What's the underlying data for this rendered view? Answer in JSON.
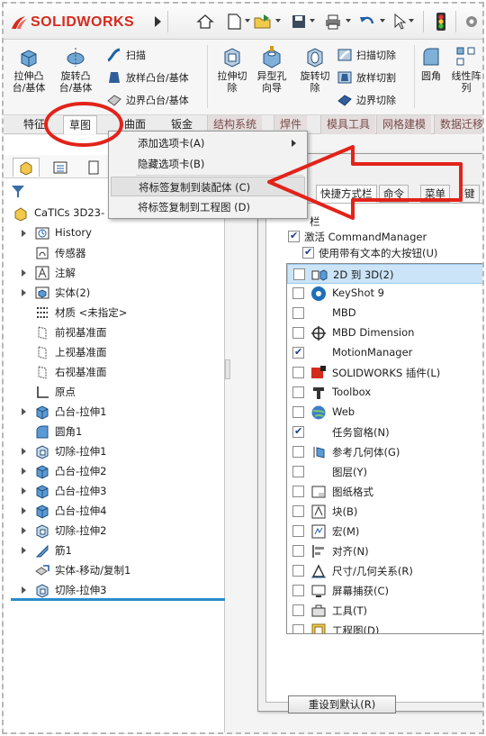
{
  "app": {
    "brand": "SOLIDWORKS"
  },
  "ribbon": {
    "items": [
      {
        "label": "拉伸凸\n台/基体",
        "icon": "extrude-boss-icon"
      },
      {
        "label": "旋转凸\n台/基体",
        "icon": "revolve-boss-icon"
      },
      {
        "label": "扫描",
        "icon": "sweep-icon"
      },
      {
        "label": "放样凸台/基体",
        "icon": "loft-icon"
      },
      {
        "label": "边界凸台/基体",
        "icon": "boundary-boss-icon"
      },
      {
        "label": "拉伸切\n除",
        "icon": "extrude-cut-icon"
      },
      {
        "label": "异型孔\n向导",
        "icon": "hole-wizard-icon"
      },
      {
        "label": "旋转切\n除",
        "icon": "revolve-cut-icon"
      },
      {
        "label": "扫描切除",
        "icon": "sweep-cut-icon"
      },
      {
        "label": "放样切割",
        "icon": "loft-cut-icon"
      },
      {
        "label": "边界切除",
        "icon": "boundary-cut-icon"
      },
      {
        "label": "圆角",
        "icon": "fillet-icon"
      },
      {
        "label": "线性阵\n列",
        "icon": "linear-pattern-icon"
      }
    ]
  },
  "tabs": [
    {
      "label": "特征"
    },
    {
      "label": "草图"
    },
    {
      "label": "曲面"
    },
    {
      "label": "钣金"
    },
    {
      "label": "结构系统"
    },
    {
      "label": "焊件"
    },
    {
      "label": "模具工具"
    },
    {
      "label": "网格建模"
    },
    {
      "label": "数据迁移"
    }
  ],
  "context_menu": {
    "items": [
      {
        "label": "添加选项卡(A)"
      },
      {
        "label": "隐藏选项卡(B)"
      },
      {
        "label": "将标签复制到装配体 (C)"
      },
      {
        "label": "将标签复制到工程图 (D)"
      }
    ]
  },
  "tree": {
    "root": "CaTICs 3D23-",
    "nodes": [
      {
        "label": "History",
        "icon": "history-folder-icon"
      },
      {
        "label": "传感器",
        "icon": "sensor-icon"
      },
      {
        "label": "注解",
        "icon": "annotation-icon"
      },
      {
        "label": "实体(2)",
        "icon": "solid-bodies-icon"
      },
      {
        "label": "材质 <未指定>",
        "icon": "material-icon"
      },
      {
        "label": "前视基准面",
        "icon": "plane-icon"
      },
      {
        "label": "上视基准面",
        "icon": "plane-icon"
      },
      {
        "label": "右视基准面",
        "icon": "plane-icon"
      },
      {
        "label": "原点",
        "icon": "origin-icon"
      },
      {
        "label": "凸台-拉伸1",
        "icon": "boss-extrude-icon"
      },
      {
        "label": "圆角1",
        "icon": "fillet-feature-icon"
      },
      {
        "label": "切除-拉伸1",
        "icon": "cut-extrude-icon"
      },
      {
        "label": "凸台-拉伸2",
        "icon": "boss-extrude-icon"
      },
      {
        "label": "凸台-拉伸3",
        "icon": "boss-extrude-icon"
      },
      {
        "label": "凸台-拉伸4",
        "icon": "boss-extrude-icon"
      },
      {
        "label": "切除-拉伸2",
        "icon": "cut-extrude-icon"
      },
      {
        "label": "筋1",
        "icon": "rib-icon"
      },
      {
        "label": "实体-移动/复制1",
        "icon": "move-copy-icon"
      },
      {
        "label": "切除-拉伸3",
        "icon": "cut-extrude-icon"
      }
    ]
  },
  "dialog": {
    "tabs": [
      {
        "label": "快捷方式栏"
      },
      {
        "label": "命令"
      },
      {
        "label": "菜单"
      },
      {
        "label": "键"
      }
    ],
    "group_label": "栏",
    "activate_cm": "激活 CommandManager",
    "large_buttons": "使用带有文本的大按钮(U)",
    "list": [
      {
        "label": "2D 到 3D(2)",
        "checked": false,
        "icon": "2d-to-3d-icon"
      },
      {
        "label": "KeyShot 9",
        "checked": false,
        "icon": "keyshot-icon"
      },
      {
        "label": "MBD",
        "checked": false,
        "icon": "mbd-icon"
      },
      {
        "label": "MBD Dimension",
        "checked": false,
        "icon": "mbd-dimension-icon"
      },
      {
        "label": "MotionManager",
        "checked": true,
        "icon": "motionmanager-icon"
      },
      {
        "label": "SOLIDWORKS 插件(L)",
        "checked": false,
        "icon": "addins-icon"
      },
      {
        "label": "Toolbox",
        "checked": false,
        "icon": "toolbox-icon"
      },
      {
        "label": "Web",
        "checked": false,
        "icon": "web-icon"
      },
      {
        "label": "任务窗格(N)",
        "checked": true,
        "icon": "task-pane-icon"
      },
      {
        "label": "参考几何体(G)",
        "checked": false,
        "icon": "ref-geometry-icon"
      },
      {
        "label": "图层(Y)",
        "checked": false,
        "icon": "layer-icon"
      },
      {
        "label": "图纸格式",
        "checked": false,
        "icon": "sheet-format-icon"
      },
      {
        "label": "块(B)",
        "checked": false,
        "icon": "block-icon"
      },
      {
        "label": "宏(M)",
        "checked": false,
        "icon": "macro-icon"
      },
      {
        "label": "对齐(N)",
        "checked": false,
        "icon": "align-icon"
      },
      {
        "label": "尺寸/几何关系(R)",
        "checked": false,
        "icon": "dimension-relations-icon"
      },
      {
        "label": "屏幕捕获(C)",
        "checked": false,
        "icon": "screen-capture-icon"
      },
      {
        "label": "工具(T)",
        "checked": false,
        "icon": "tools-icon"
      },
      {
        "label": "工程图(D)",
        "checked": false,
        "icon": "drawing-icon"
      }
    ],
    "reset_label": "重设到默认(R)"
  },
  "colors": {
    "accent": "#d52b1e",
    "annotation": "#e2231a",
    "selection": "#cce4f7"
  }
}
